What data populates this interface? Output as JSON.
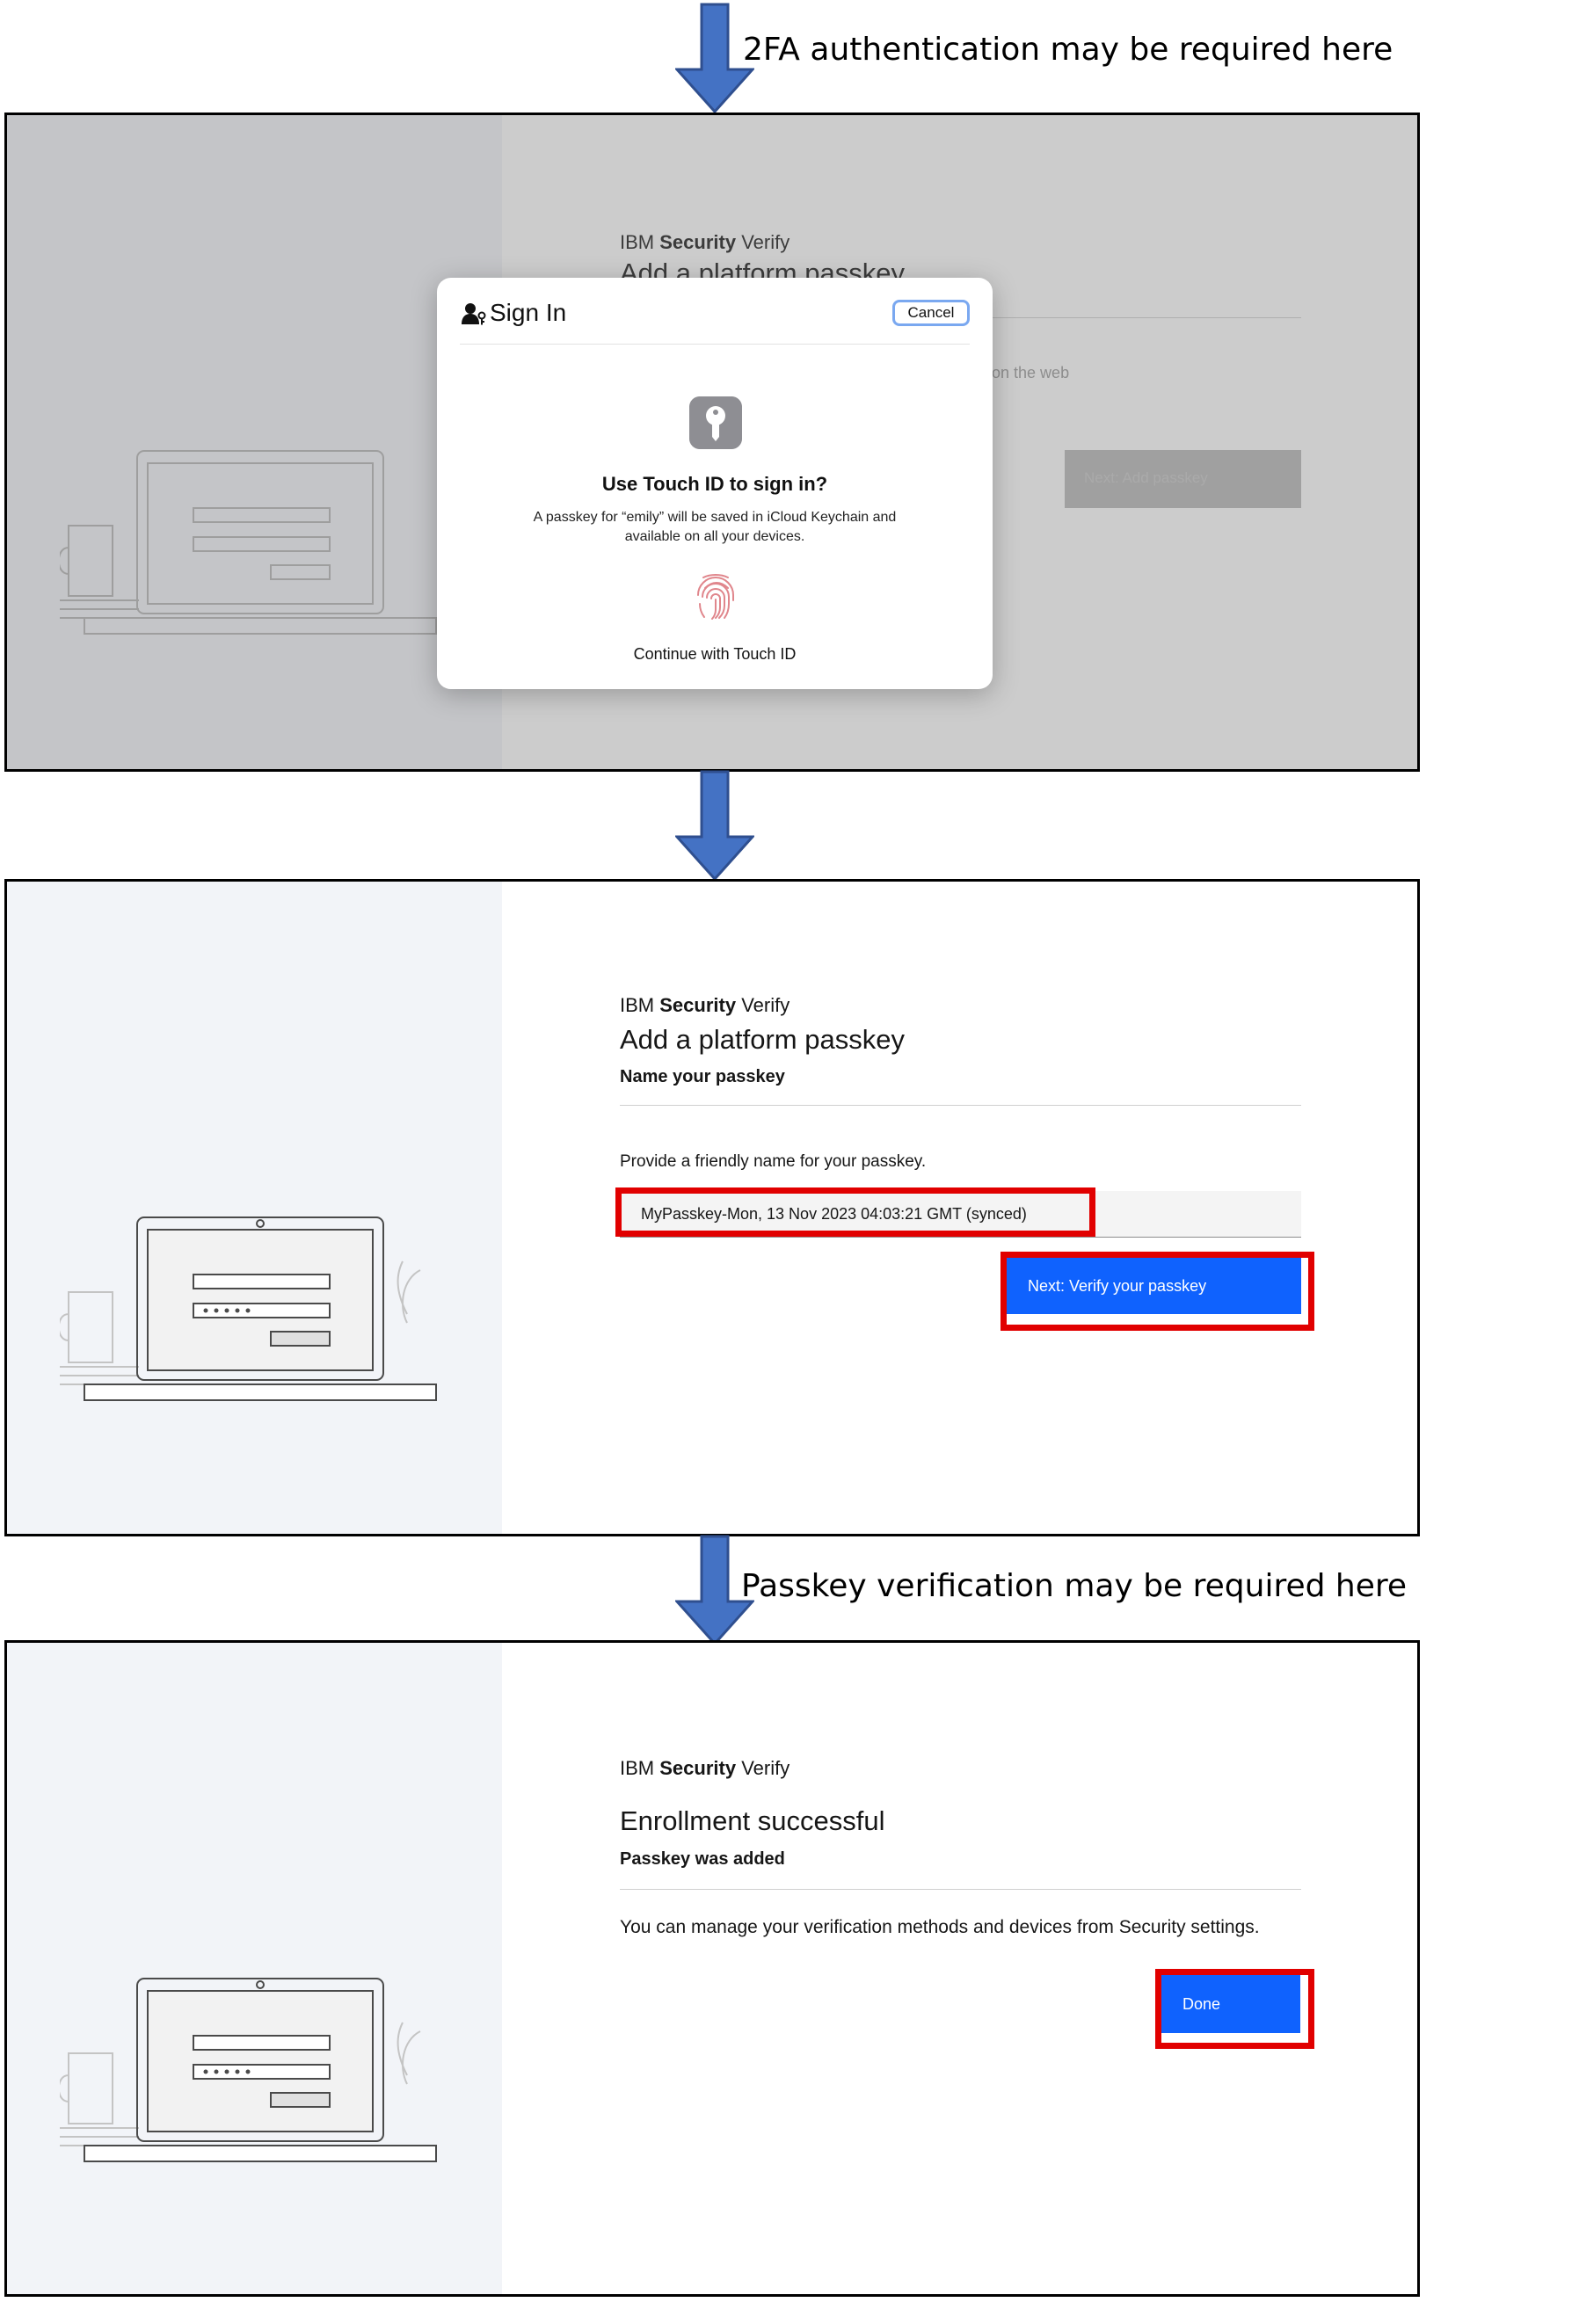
{
  "annotations": {
    "note_top": "2FA authentication may be required here",
    "note_bottom": "Passkey verification may be required here"
  },
  "brand": {
    "ibm": "IBM",
    "security": "Security",
    "verify": "Verify"
  },
  "panel1": {
    "bg_title": "Add a platform passkey",
    "bg_text_fragment": "te on the web",
    "bg_button": "Next: Add passkey",
    "dialog": {
      "title": "Sign In",
      "cancel": "Cancel",
      "heading": "Use Touch ID to sign in?",
      "message_line1": "A passkey for “emily” will be saved in iCloud Keychain and",
      "message_line2": "available on all your devices.",
      "continue": "Continue with Touch ID"
    }
  },
  "panel2": {
    "title": "Add a platform passkey",
    "subtitle": "Name your passkey",
    "instruction": "Provide a friendly name for your passkey.",
    "passkey_name": "MyPasskey-Mon, 13 Nov 2023 04:03:21 GMT  (synced)",
    "next_button": "Next: Verify your passkey"
  },
  "panel3": {
    "title": "Enrollment successful",
    "subtitle": "Passkey was added",
    "message": "You can manage your verification methods and devices from Security settings.",
    "done_button": "Done"
  },
  "colors": {
    "arrow": "#4472c4",
    "primary_button": "#0f62fe",
    "highlight_box": "#e10000",
    "left_pane": "#f2f4f8"
  },
  "icons": [
    "down-arrow-icon",
    "user-key-icon",
    "key-icon",
    "fingerprint-icon",
    "laptop-illustration"
  ]
}
